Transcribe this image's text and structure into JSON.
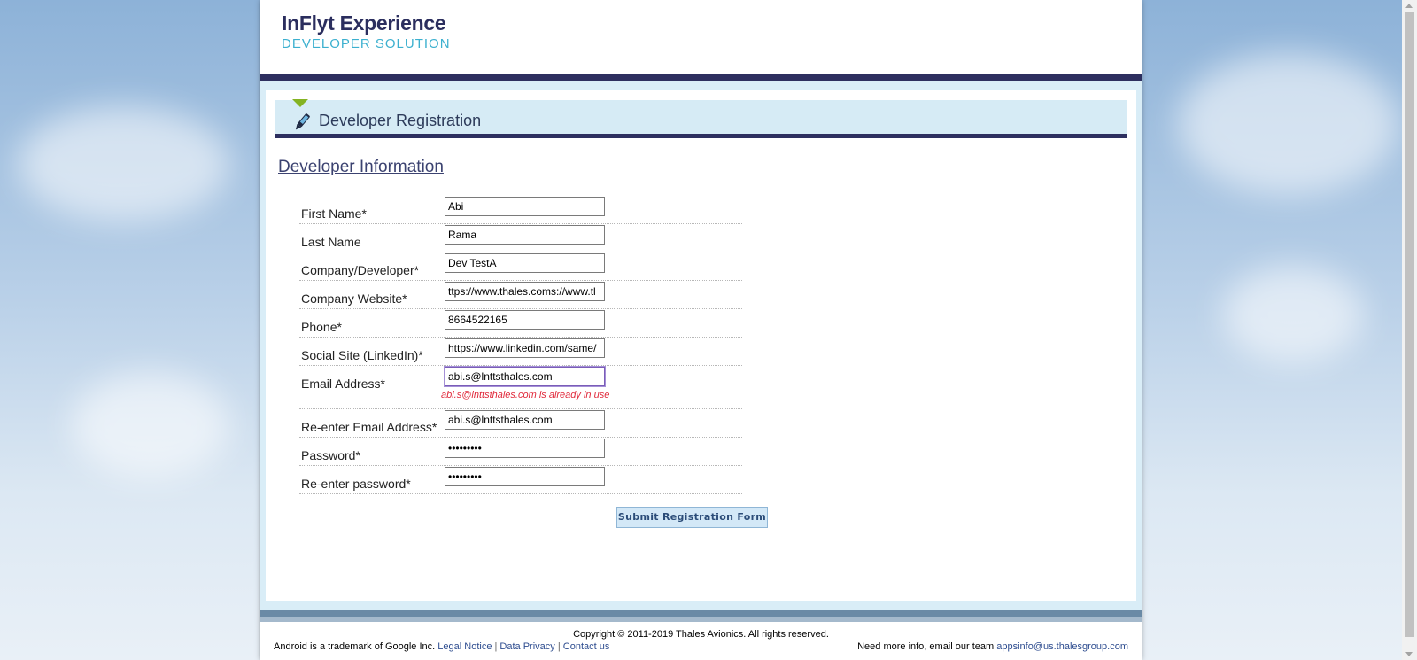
{
  "logo": {
    "title": "InFlyt Experience",
    "subtitle": "DEVELOPER SOLUTION"
  },
  "header": {
    "title": "Developer Registration",
    "icon": "pen-icon"
  },
  "section": {
    "title": "Developer Information"
  },
  "form": {
    "fields": [
      {
        "label": "First Name*",
        "value": "Abi"
      },
      {
        "label": "Last Name",
        "value": "Rama"
      },
      {
        "label": "Company/Developer*",
        "value": "Dev TestA"
      },
      {
        "label": "Company Website*",
        "value": "ttps://www.thales.coms://www.tl"
      },
      {
        "label": "Phone*",
        "value": "8664522165"
      },
      {
        "label": "Social Site (LinkedIn)*",
        "value": "https://www.linkedin.com/same/"
      },
      {
        "label": "Email Address*",
        "value": "abi.s@lnttsthales.com",
        "error": "abi.s@lnttsthales.com is already in use"
      },
      {
        "label": "Re-enter Email Address*",
        "value": "abi.s@lnttsthales.com"
      },
      {
        "label": "Password*",
        "value": "•••••••••"
      },
      {
        "label": "Re-enter password*",
        "value": "•••••••••"
      }
    ],
    "submit_label": "Submit Registration Form"
  },
  "footer": {
    "copyright": "Copyright © 2011-2019 Thales Avionics. All rights reserved.",
    "trademark": "Android is a trademark of Google Inc.",
    "legal_notice": "Legal Notice",
    "data_privacy": "Data Privacy",
    "contact_us": "Contact us",
    "separator": "|",
    "more_info": "Need more info, email our team",
    "email": "appsinfo@us.thalesgroup.com"
  },
  "colors": {
    "navy": "#2d2f5f",
    "accent_green": "#84b322",
    "error_red": "#e0283a",
    "link_blue": "#2d4c8f"
  }
}
